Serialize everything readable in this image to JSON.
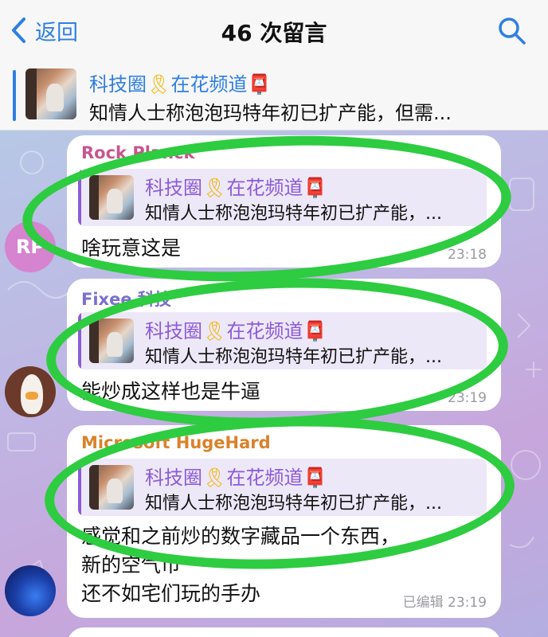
{
  "header": {
    "back_label": "返回",
    "title": "46 次留言",
    "search_icon": "search-icon"
  },
  "pinned": {
    "channel_name": "科技圈",
    "channel_suffix": "在花频道",
    "ribbon_glyph": "🎗",
    "mailbox_glyph": "📮",
    "text": "知情人士称泡泡玛特年初已扩产能，但需..."
  },
  "messages": [
    {
      "sender": "Rock Planck",
      "sender_color": "#c8558f",
      "avatar_initials": "RP",
      "reply_title": "科技圈",
      "reply_suffix": "在花频道",
      "reply_text": "知情人士称泡泡玛特年初已扩产能，...",
      "lines": [
        "啥玩意这是"
      ],
      "time": "23:18"
    },
    {
      "sender": "Fixee 科技",
      "sender_color": "#7a6fd0",
      "reply_title": "科技圈",
      "reply_suffix": "在花频道",
      "reply_text": "知情人士称泡泡玛特年初已扩产能，...",
      "lines": [
        "能炒成这样也是牛逼"
      ],
      "time": "23:19"
    },
    {
      "sender": "Microsoft HugeHard",
      "sender_color": "#d9822b",
      "reply_title": "科技圈",
      "reply_suffix": "在花频道",
      "reply_text": "知情人士称泡泡玛特年初已扩产能，...",
      "lines": [
        "感觉和之前炒的数字藏品一个东西，",
        "新的空气币",
        "还不如宅们玩的手办"
      ],
      "edited": "已编辑",
      "time": "23:19"
    }
  ],
  "colors": {
    "accent": "#2f7fe0",
    "annotation_circle": "#2ecc40"
  }
}
